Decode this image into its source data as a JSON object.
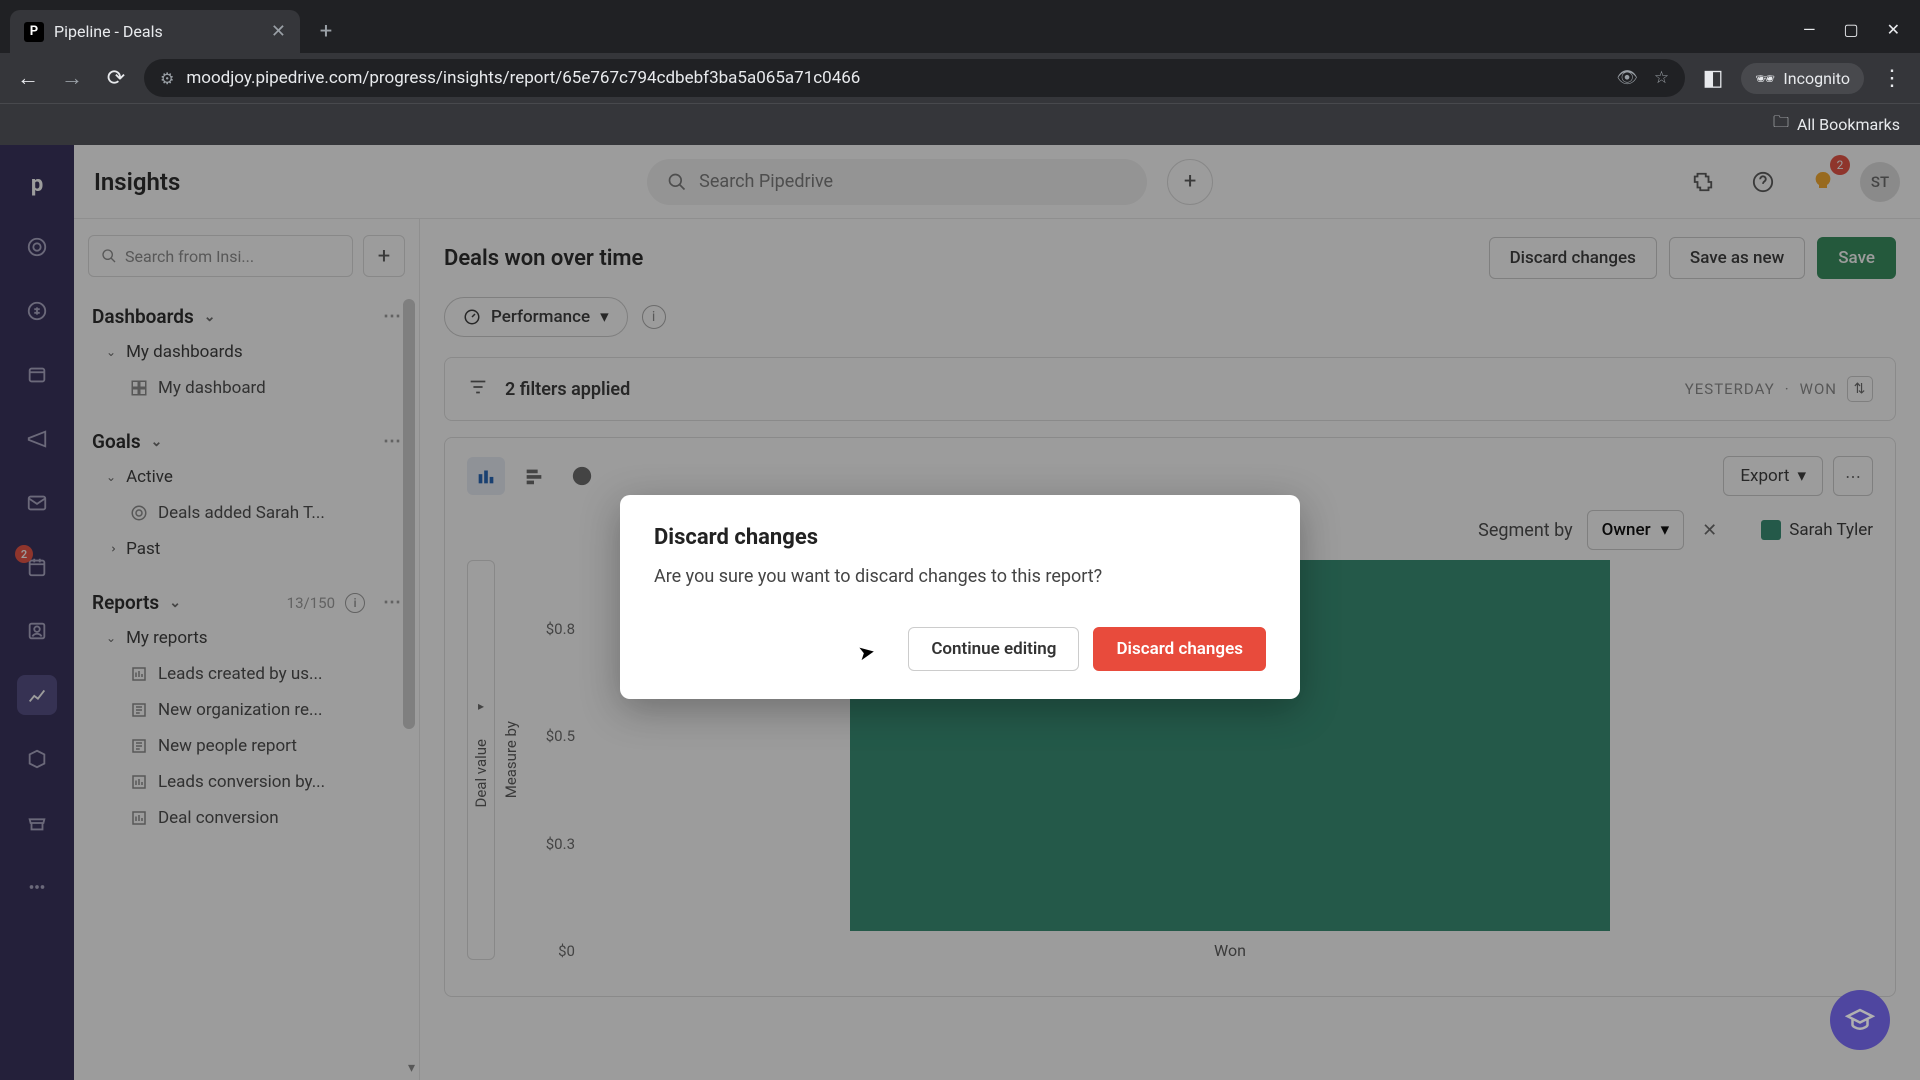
{
  "browser": {
    "tab_title": "Pipeline - Deals",
    "tab_favicon": "P",
    "url": "moodjoy.pipedrive.com/progress/insights/report/65e767c794cdbebf3ba5a065a71c0466",
    "incognito_label": "Incognito",
    "bookmarks_label": "All Bookmarks"
  },
  "header": {
    "title": "Insights",
    "search_placeholder": "Search Pipedrive",
    "bulb_count": "2",
    "avatar_initials": "ST"
  },
  "sidebar": {
    "search_placeholder": "Search from Insi...",
    "dashboards": {
      "label": "Dashboards",
      "sub_label": "My dashboards",
      "items": [
        "My dashboard"
      ]
    },
    "goals": {
      "label": "Goals",
      "active_label": "Active",
      "active_items": [
        "Deals added Sarah T..."
      ],
      "past_label": "Past"
    },
    "reports": {
      "label": "Reports",
      "count": "13/150",
      "sub_label": "My reports",
      "items": [
        "Leads created by us...",
        "New organization re...",
        "New people report",
        "Leads conversion by...",
        "Deal conversion"
      ]
    }
  },
  "rail": {
    "badge": "2"
  },
  "panel": {
    "title": "Deals won over time",
    "discard_btn": "Discard changes",
    "save_as_btn": "Save as new",
    "save_btn": "Save",
    "performance_label": "Performance",
    "filters_label": "2 filters applied",
    "filter_chips": [
      "YESTERDAY",
      "WON"
    ],
    "export_label": "Export",
    "segment_label": "Segment by",
    "segment_value": "Owner",
    "legend_name": "Sarah Tyler",
    "y_label": "Deal value",
    "measure_label": "Measure by",
    "x_label": "Won"
  },
  "chart_data": {
    "type": "bar",
    "categories": [
      "Won"
    ],
    "series": [
      {
        "name": "Sarah Tyler",
        "values": [
          0.8
        ]
      }
    ],
    "ylabel": "Deal value",
    "yticks": [
      "$0.8",
      "$0.5",
      "$0.3",
      "$0"
    ],
    "ylim": [
      0,
      0.8
    ],
    "unit": "$"
  },
  "modal": {
    "title": "Discard changes",
    "body": "Are you sure you want to discard changes to this report?",
    "continue_btn": "Continue editing",
    "discard_btn": "Discard changes"
  }
}
